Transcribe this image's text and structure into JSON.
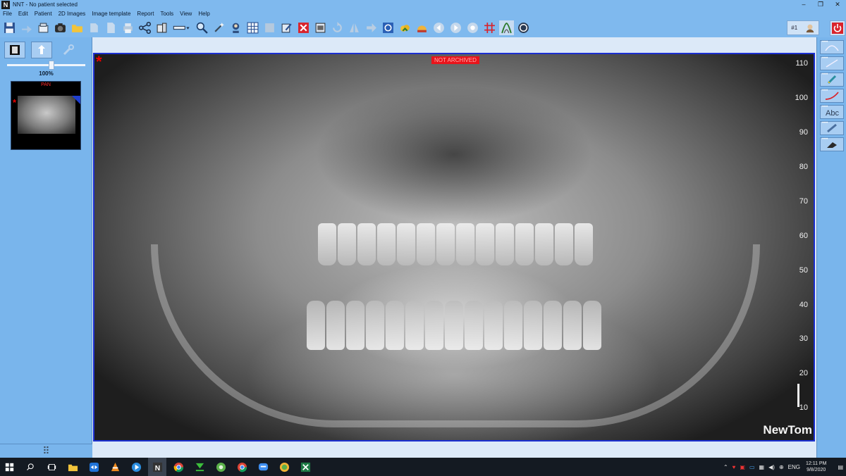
{
  "window": {
    "app_icon_letter": "N",
    "title": "NNT - No patient selected",
    "controls": {
      "minimize": "–",
      "restore": "❐",
      "close": "✕"
    }
  },
  "menu": [
    "File",
    "Edit",
    "Patient",
    "2D Images",
    "Image template",
    "Report",
    "Tools",
    "View",
    "Help"
  ],
  "toolbar": {
    "patient_badge_text": "#1"
  },
  "left_panel": {
    "zoom_level": "100%",
    "zoom_fraction": 0.57,
    "thumbnail": {
      "name": "PAN",
      "marker": "*"
    },
    "footer_icon": "⠿"
  },
  "viewer": {
    "marker": "*",
    "status_label": "NOT ARCHIVED",
    "ruler_ticks": [
      "110",
      "100",
      "90",
      "80",
      "70",
      "60",
      "50",
      "40",
      "30",
      "20",
      "10"
    ],
    "brand": "NewTom"
  },
  "taskbar": {
    "tray_language": "ENG",
    "clock_time": "12:11 PM",
    "clock_date": "9/8/2020"
  },
  "colors": {
    "chrome_blue": "#7fb9ee",
    "panel_blue": "#79b5ec",
    "viewer_border": "#1b2fd1",
    "archive_red": "#e8141b",
    "taskbar": "#141a22"
  }
}
